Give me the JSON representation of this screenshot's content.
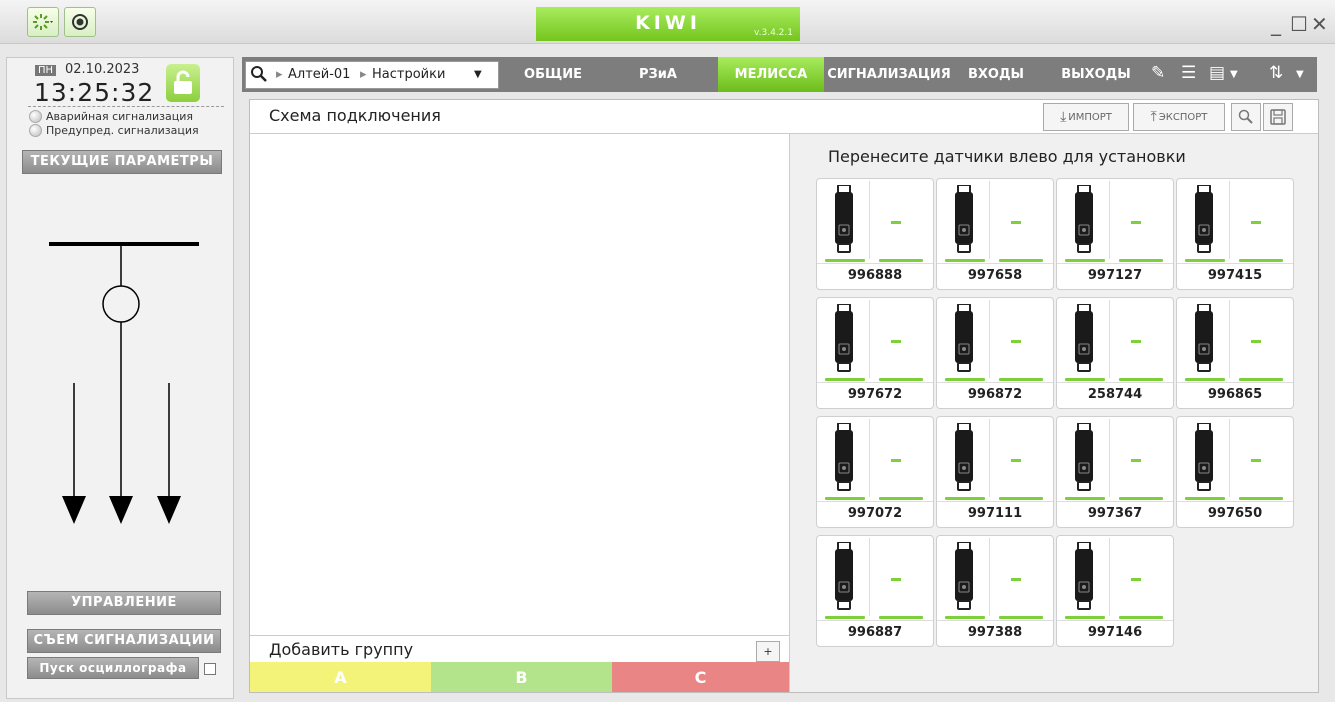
{
  "app": {
    "name": "KIWI",
    "version": "v.3.4.2.1"
  },
  "window_controls": [
    "_",
    "☐",
    "✕"
  ],
  "left_panel": {
    "day": "ПН",
    "date": "02.10.2023",
    "time": "13:25:32",
    "alarms": [
      "Аварийная сигнализация",
      "Предупред. сигнализация"
    ],
    "current_params_button": "ТЕКУЩИЕ ПАРАМЕТРЫ",
    "control_button": "УПРАВЛЕНИЕ",
    "reset_alarm_button": "СЪЕМ СИГНАЛИЗАЦИИ",
    "oscillograph_button": "Пуск осциллографа"
  },
  "breadcrumb": {
    "device": "Алтей-01",
    "section": "Настройки"
  },
  "tabs": [
    "ОБЩИЕ",
    "РЗиА",
    "МЕЛИССА",
    "СИГНАЛИЗАЦИЯ",
    "ВХОДЫ",
    "ВЫХОДЫ"
  ],
  "active_tab": "МЕЛИССА",
  "content": {
    "title": "Схема подключения",
    "import_label": "ИМПОРТ",
    "export_label": "ЭКСПОРТ",
    "sensors_title": "Перенесите датчики влево для установки",
    "add_group_label": "Добавить группу",
    "add_button_label": "+",
    "phases": [
      "A",
      "B",
      "C"
    ]
  },
  "sensors": [
    {
      "id": "996888",
      "value": "-"
    },
    {
      "id": "997658",
      "value": "-"
    },
    {
      "id": "997127",
      "value": "-"
    },
    {
      "id": "997415",
      "value": "-"
    },
    {
      "id": "997672",
      "value": "-"
    },
    {
      "id": "996872",
      "value": "-"
    },
    {
      "id": "258744",
      "value": "-"
    },
    {
      "id": "996865",
      "value": "-"
    },
    {
      "id": "997072",
      "value": "-"
    },
    {
      "id": "997111",
      "value": "-"
    },
    {
      "id": "997367",
      "value": "-"
    },
    {
      "id": "997650",
      "value": "-"
    },
    {
      "id": "996887",
      "value": "-"
    },
    {
      "id": "997388",
      "value": "-"
    },
    {
      "id": "997146",
      "value": "-"
    }
  ],
  "colors": {
    "accent": "#7ed03a",
    "phase_a": "#f3f37a",
    "phase_b": "#b3e38a",
    "phase_c": "#ea8585"
  }
}
